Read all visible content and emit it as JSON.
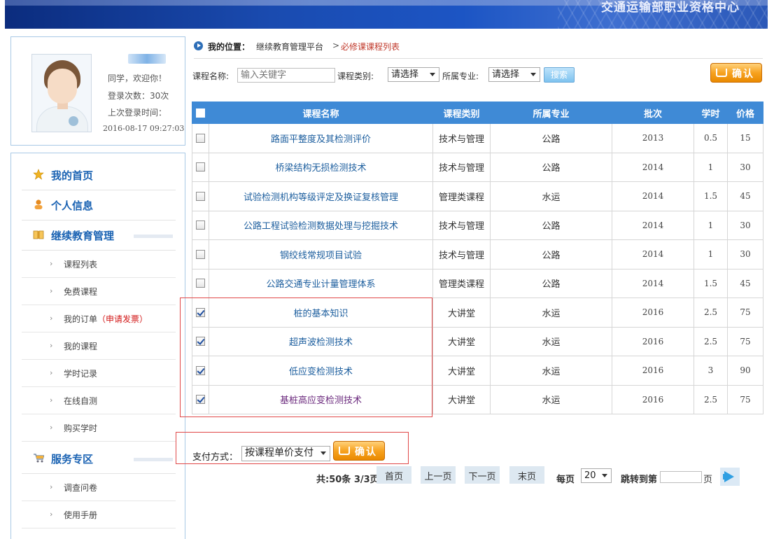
{
  "header": {
    "title": "交通运输部职业资格中心"
  },
  "user": {
    "greeting": "同学，欢迎你！",
    "login_count": "登录次数：30次",
    "last_login_label": "上次登录时间：",
    "last_login_time": "2016-08-17 09:27:03"
  },
  "menu": {
    "home": "我的首页",
    "profile": "个人信息",
    "edu": "继续教育管理",
    "items": [
      "课程列表",
      "免费课程",
      "我的订单",
      "我的课程",
      "学时记录",
      "在线自测",
      "购买学时"
    ],
    "invoice": "（申请发票）",
    "service": "服务专区",
    "service_items": [
      "调查问卷",
      "使用手册"
    ]
  },
  "breadcrumb": {
    "label": "我的位置：",
    "root": "继续教育管理平台",
    "sep": ">",
    "current": "必修课课程列表"
  },
  "search": {
    "name_label": "课程名称:",
    "name_placeholder": "输入关键字",
    "type_label": "课程类别:",
    "type_value": "请选择",
    "major_label": "所属专业:",
    "major_value": "请选择",
    "search_button": "搜索",
    "confirm_button": "确认"
  },
  "table": {
    "headers": [
      "课程名称",
      "课程类别",
      "所属专业",
      "批次",
      "学时",
      "价格"
    ],
    "rows": [
      {
        "name": "路面平整度及其检测评价",
        "type": "技术与管理",
        "major": "公路",
        "batch": "2013",
        "hours": "0.5",
        "price": "15",
        "checked": false
      },
      {
        "name": "桥梁结构无损检测技术",
        "type": "技术与管理",
        "major": "公路",
        "batch": "2014",
        "hours": "1",
        "price": "30",
        "checked": false
      },
      {
        "name": "试验检测机构等级评定及换证复核管理",
        "type": "管理类课程",
        "major": "水运",
        "batch": "2014",
        "hours": "1.5",
        "price": "45",
        "checked": false
      },
      {
        "name": "公路工程试验检测数据处理与挖掘技术",
        "type": "技术与管理",
        "major": "公路",
        "batch": "2014",
        "hours": "1",
        "price": "30",
        "checked": false
      },
      {
        "name": "钢绞线常规项目试验",
        "type": "技术与管理",
        "major": "公路",
        "batch": "2014",
        "hours": "1",
        "price": "30",
        "checked": false
      },
      {
        "name": "公路交通专业计量管理体系",
        "type": "管理类课程",
        "major": "公路",
        "batch": "2014",
        "hours": "1.5",
        "price": "45",
        "checked": false
      },
      {
        "name": "桩的基本知识",
        "type": "大讲堂",
        "major": "水运",
        "batch": "2016",
        "hours": "2.5",
        "price": "75",
        "checked": true
      },
      {
        "name": "超声波检测技术",
        "type": "大讲堂",
        "major": "水运",
        "batch": "2016",
        "hours": "2.5",
        "price": "75",
        "checked": true
      },
      {
        "name": "低应变检测技术",
        "type": "大讲堂",
        "major": "水运",
        "batch": "2016",
        "hours": "3",
        "price": "90",
        "checked": true
      },
      {
        "name": "基桩高应变检测技术",
        "type": "大讲堂",
        "major": "水运",
        "batch": "2016",
        "hours": "2.5",
        "price": "75",
        "checked": true
      }
    ]
  },
  "payment": {
    "label": "支付方式：",
    "value": "按课程单价支付",
    "confirm_button": "确认"
  },
  "pager": {
    "summary": "共:50条 3/3页",
    "first": "首页",
    "prev": "上一页",
    "next": "下一页",
    "last": "末页",
    "per_page_label": "每页",
    "per_page_value": "20",
    "jump_label": "跳转到第",
    "page_suffix": "页"
  },
  "colors": {
    "table_header": "#3f8ad6",
    "menu_blue": "#1b63b3",
    "highlight_box": "#e04848",
    "confirm_orange": "#f7a21f"
  }
}
